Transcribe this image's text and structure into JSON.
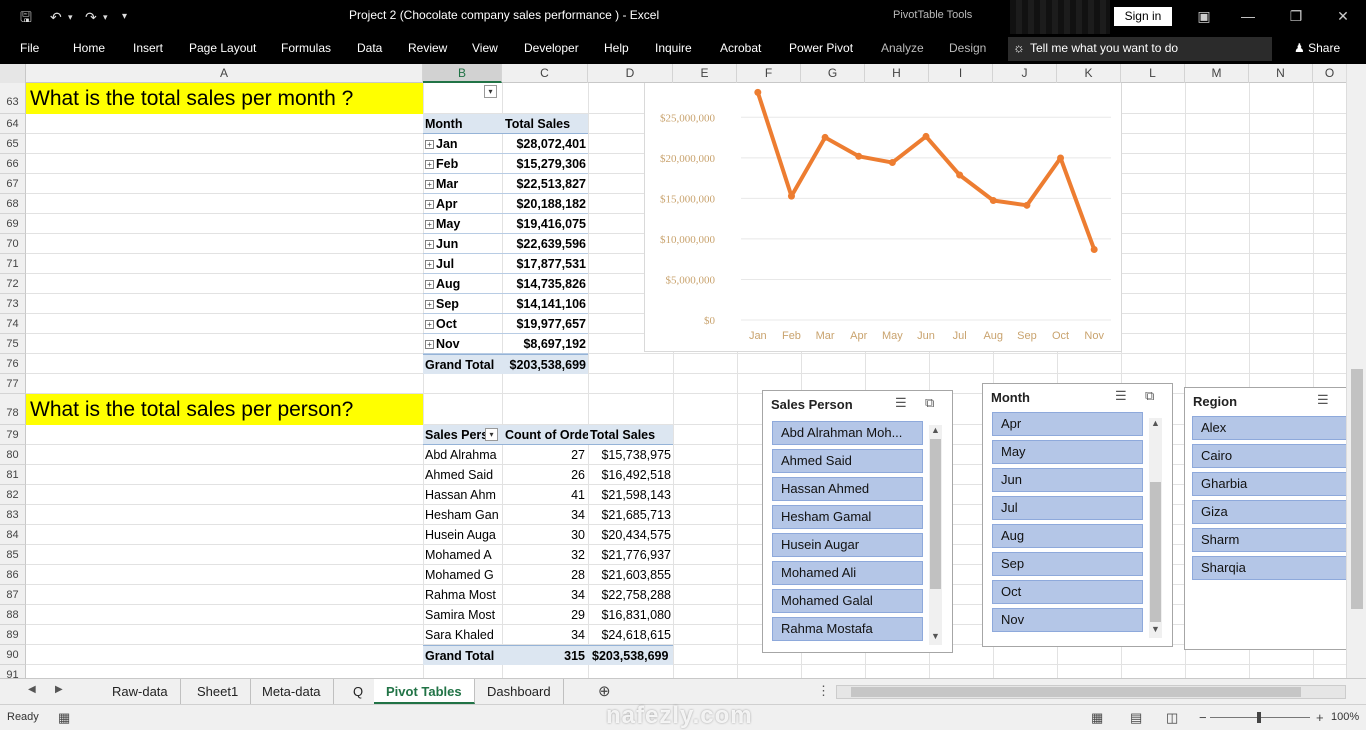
{
  "window": {
    "title": "Project 2 (Chocolate company sales performance )  -  Excel",
    "context_tools": "PivotTable Tools",
    "sign_in": "Sign in"
  },
  "ribbon": {
    "tabs": [
      "File",
      "Home",
      "Insert",
      "Page Layout",
      "Formulas",
      "Data",
      "Review",
      "View",
      "Developer",
      "Help",
      "Inquire",
      "Acrobat",
      "Power Pivot"
    ],
    "context_tabs": [
      "Analyze",
      "Design"
    ],
    "tell_me": "Tell me what you want to do",
    "share": "Share"
  },
  "columns": [
    "A",
    "B",
    "C",
    "D",
    "E",
    "F",
    "G",
    "H",
    "I",
    "J",
    "K",
    "L",
    "M",
    "N",
    "O"
  ],
  "rows": [
    "63",
    "64",
    "65",
    "66",
    "67",
    "68",
    "69",
    "70",
    "71",
    "72",
    "73",
    "74",
    "75",
    "76",
    "77",
    "78",
    "79",
    "80",
    "81",
    "82",
    "83",
    "84",
    "85",
    "86",
    "87",
    "88",
    "89",
    "90",
    "91"
  ],
  "q1": "What is the total sales per month ?",
  "q2": "What is the total sales per person?",
  "pivot1": {
    "col1": "Month",
    "col2": "Total Sales",
    "rows": [
      {
        "label": "Jan",
        "value": "$28,072,401"
      },
      {
        "label": "Feb",
        "value": "$15,279,306"
      },
      {
        "label": "Mar",
        "value": "$22,513,827"
      },
      {
        "label": "Apr",
        "value": "$20,188,182"
      },
      {
        "label": "May",
        "value": "$19,416,075"
      },
      {
        "label": "Jun",
        "value": "$22,639,596"
      },
      {
        "label": "Jul",
        "value": "$17,877,531"
      },
      {
        "label": "Aug",
        "value": "$14,735,826"
      },
      {
        "label": "Sep",
        "value": "$14,141,106"
      },
      {
        "label": "Oct",
        "value": "$19,977,657"
      },
      {
        "label": "Nov",
        "value": "$8,697,192"
      }
    ],
    "total_label": "Grand Total",
    "total_value": "$203,538,699"
  },
  "pivot2": {
    "col1": "Sales Pers",
    "col2": "Count of Orde",
    "col3": "Total Sales",
    "rows": [
      {
        "name": "Abd Alrahma",
        "count": "27",
        "sales": "$15,738,975"
      },
      {
        "name": "Ahmed Said",
        "count": "26",
        "sales": "$16,492,518"
      },
      {
        "name": "Hassan Ahm",
        "count": "41",
        "sales": "$21,598,143"
      },
      {
        "name": "Hesham Gan",
        "count": "34",
        "sales": "$21,685,713"
      },
      {
        "name": "Husein Auga",
        "count": "30",
        "sales": "$20,434,575"
      },
      {
        "name": "Mohamed A",
        "count": "32",
        "sales": "$21,776,937"
      },
      {
        "name": "Mohamed G",
        "count": "28",
        "sales": "$21,603,855"
      },
      {
        "name": "Rahma Most",
        "count": "34",
        "sales": "$22,758,288"
      },
      {
        "name": "Samira Most",
        "count": "29",
        "sales": "$16,831,080"
      },
      {
        "name": "Sara Khaled",
        "count": "34",
        "sales": "$24,618,615"
      }
    ],
    "total_label": "Grand Total",
    "total_count": "315",
    "total_sales": "$203,538,699"
  },
  "chart_data": {
    "type": "line",
    "categories": [
      "Jan",
      "Feb",
      "Mar",
      "Apr",
      "May",
      "Jun",
      "Jul",
      "Aug",
      "Sep",
      "Oct",
      "Nov"
    ],
    "values": [
      28072401,
      15279306,
      22513827,
      20188182,
      19416075,
      22639596,
      17877531,
      14735826,
      14141106,
      19977657,
      8697192
    ],
    "y_ticks": [
      "$0",
      "$5,000,000",
      "$10,000,000",
      "$15,000,000",
      "$20,000,000",
      "$25,000,000"
    ],
    "ylim": [
      0,
      25000000
    ],
    "line_color": "#ed7d31",
    "label_color": "#c9a36e",
    "grid": true,
    "legend": "none"
  },
  "slicers": {
    "person": {
      "title": "Sales Person",
      "items": [
        "Abd Alrahman Moh...",
        "Ahmed Said",
        "Hassan Ahmed",
        "Hesham Gamal",
        "Husein Augar",
        "Mohamed Ali",
        "Mohamed Galal",
        "Rahma Mostafa"
      ]
    },
    "month": {
      "title": "Month",
      "items": [
        "Apr",
        "May",
        "Jun",
        "Jul",
        "Aug",
        "Sep",
        "Oct",
        "Nov"
      ]
    },
    "region": {
      "title": "Region",
      "items": [
        "Alex",
        "Cairo",
        "Gharbia",
        "Giza",
        "Sharm",
        "Sharqia"
      ]
    }
  },
  "sheets": [
    "Raw-data",
    "Sheet1",
    "Meta-data",
    "Q",
    "Pivot Tables",
    "Dashboard"
  ],
  "active_sheet": "Pivot Tables",
  "status": {
    "ready": "Ready",
    "zoom": "100%"
  },
  "watermark": "nafezly.com"
}
